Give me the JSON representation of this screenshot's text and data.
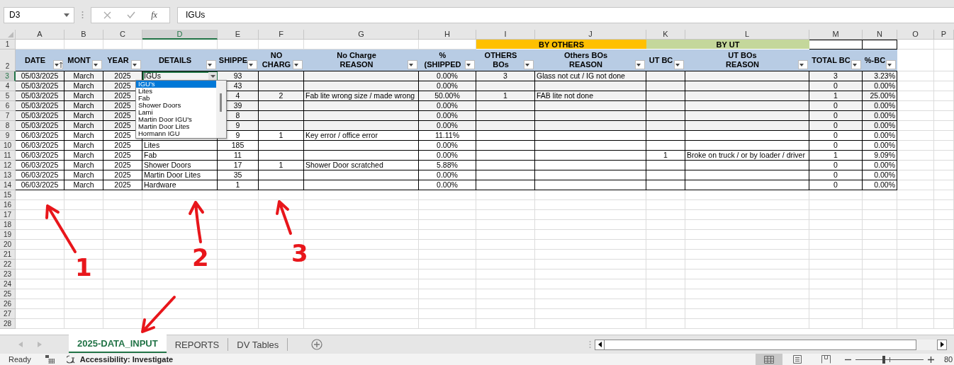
{
  "name_box": "D3",
  "function_button": "fx",
  "formula": "IGUs",
  "columns": [
    {
      "label": "A",
      "selected": false
    },
    {
      "label": "B",
      "selected": false
    },
    {
      "label": "C",
      "selected": false
    },
    {
      "label": "D",
      "selected": true
    },
    {
      "label": "E",
      "selected": false
    },
    {
      "label": "F",
      "selected": false
    },
    {
      "label": "G",
      "selected": false
    },
    {
      "label": "H",
      "selected": false
    },
    {
      "label": "I",
      "selected": false
    },
    {
      "label": "J",
      "selected": false
    },
    {
      "label": "K",
      "selected": false
    },
    {
      "label": "L",
      "selected": false
    },
    {
      "label": "M",
      "selected": false
    },
    {
      "label": "N",
      "selected": false
    },
    {
      "label": "O",
      "selected": false
    },
    {
      "label": "P",
      "selected": false
    }
  ],
  "group_headers": [
    {
      "label": "BY OTHERS",
      "color": "#ffc000"
    },
    {
      "label": "BY UT",
      "color": "#c4d79b"
    }
  ],
  "header_row": "2",
  "first_row": "1",
  "headers": [
    {
      "label": "DATE",
      "sorted": true
    },
    {
      "label": "MONT",
      "sorted": false
    },
    {
      "label": "YEAR",
      "sorted": false
    },
    {
      "label": "DETAILS",
      "sorted": false
    },
    {
      "label": "SHIPPE",
      "sorted": false
    },
    {
      "label": "NO\nCHARG",
      "sorted": false
    },
    {
      "label": "No Charge\nREASON",
      "sorted": false
    },
    {
      "label": "% (SHIPPED",
      "sorted": false
    },
    {
      "label": "OTHERS\nBOs",
      "sorted": false
    },
    {
      "label": "Others BOs\nREASON",
      "sorted": false
    },
    {
      "label": "UT BC",
      "sorted": false
    },
    {
      "label": "UT BOs\nREASON",
      "sorted": false
    },
    {
      "label": "TOTAL BC",
      "sorted": false
    },
    {
      "label": "%-BC",
      "sorted": false
    }
  ],
  "rows": [
    {
      "number": "3",
      "selected": true,
      "shaded": true,
      "date": "05/03/2025",
      "month": "March",
      "year": "2025",
      "details": "IGUs",
      "shipped": "93",
      "pct_shipped": "0.00%",
      "others_bos": "3",
      "others_reason": "Glass not cut / IG not done",
      "total_bos": "3",
      "pct_bos": "3.23%"
    },
    {
      "number": "4",
      "selected": false,
      "shaded": true,
      "date": "05/03/2025",
      "month": "March",
      "year": "2025",
      "shipped": "43",
      "pct_shipped": "0.00%",
      "total_bos": "0",
      "pct_bos": "0.00%"
    },
    {
      "number": "5",
      "selected": false,
      "shaded": true,
      "date": "05/03/2025",
      "month": "March",
      "year": "2025",
      "shipped": "4",
      "no_charge": "2",
      "no_charge_reason": "Fab lite wrong size / made wrong",
      "pct_shipped": "50.00%",
      "others_bos": "1",
      "others_reason": "FAB lite not done",
      "total_bos": "1",
      "pct_bos": "25.00%"
    },
    {
      "number": "6",
      "selected": false,
      "shaded": true,
      "date": "05/03/2025",
      "month": "March",
      "year": "2025",
      "shipped": "39",
      "pct_shipped": "0.00%",
      "total_bos": "0",
      "pct_bos": "0.00%"
    },
    {
      "number": "7",
      "selected": false,
      "shaded": true,
      "date": "05/03/2025",
      "month": "March",
      "year": "2025",
      "shipped": "8",
      "pct_shipped": "0.00%",
      "total_bos": "0",
      "pct_bos": "0.00%"
    },
    {
      "number": "8",
      "selected": false,
      "shaded": true,
      "date": "05/03/2025",
      "month": "March",
      "year": "2025",
      "shipped": "9",
      "pct_shipped": "0.00%",
      "total_bos": "0",
      "pct_bos": "0.00%"
    },
    {
      "number": "9",
      "selected": false,
      "shaded": false,
      "date": "06/03/2025",
      "month": "March",
      "year": "2025",
      "shipped": "9",
      "no_charge": "1",
      "no_charge_reason": "Key error / office error",
      "pct_shipped": "11.11%",
      "total_bos": "0",
      "pct_bos": "0.00%"
    },
    {
      "number": "10",
      "selected": false,
      "shaded": false,
      "date": "06/03/2025",
      "month": "March",
      "year": "2025",
      "details": "Lites",
      "shipped": "185",
      "pct_shipped": "0.00%",
      "total_bos": "0",
      "pct_bos": "0.00%"
    },
    {
      "number": "11",
      "selected": false,
      "shaded": false,
      "date": "06/03/2025",
      "month": "March",
      "year": "2025",
      "details": "Fab",
      "shipped": "11",
      "pct_shipped": "0.00%",
      "ut_bos": "1",
      "ut_reason": "Broke on truck / or by loader / driver",
      "total_bos": "1",
      "pct_bos": "9.09%"
    },
    {
      "number": "12",
      "selected": false,
      "shaded": false,
      "date": "06/03/2025",
      "month": "March",
      "year": "2025",
      "details": "Shower Doors",
      "shipped": "17",
      "no_charge": "1",
      "no_charge_reason": "Shower Door scratched",
      "pct_shipped": "5.88%",
      "total_bos": "0",
      "pct_bos": "0.00%"
    },
    {
      "number": "13",
      "selected": false,
      "shaded": false,
      "date": "06/03/2025",
      "month": "March",
      "year": "2025",
      "details": "Martin Door Lites",
      "shipped": "35",
      "pct_shipped": "0.00%",
      "total_bos": "0",
      "pct_bos": "0.00%"
    },
    {
      "number": "14",
      "selected": false,
      "shaded": false,
      "date": "06/03/2025",
      "month": "March",
      "year": "2025",
      "details": "Hardware",
      "shipped": "1",
      "pct_shipped": "0.00%",
      "total_bos": "0",
      "pct_bos": "0.00%"
    }
  ],
  "empty_rows": [
    "15",
    "16",
    "17",
    "18",
    "19",
    "20",
    "21",
    "22",
    "23",
    "24",
    "25",
    "26",
    "27",
    "28"
  ],
  "dropdown": {
    "items": [
      {
        "label": "IGU's",
        "selected": true
      },
      {
        "label": "Lites",
        "selected": false
      },
      {
        "label": "Fab",
        "selected": false
      },
      {
        "label": "Shower Doors",
        "selected": false
      },
      {
        "label": "Lami",
        "selected": false
      },
      {
        "label": "Martin Door IGU's",
        "selected": false
      },
      {
        "label": "Martin Door Lites",
        "selected": false
      },
      {
        "label": "Hormann IGU",
        "selected": false
      }
    ]
  },
  "annotations": [
    {
      "kind": "numbered",
      "label": "1"
    },
    {
      "kind": "numbered",
      "label": "2"
    },
    {
      "kind": "numbered",
      "label": "3"
    },
    {
      "kind": "arrow"
    }
  ],
  "sheet_tabs": [
    {
      "label": "2025-DATA_INPUT",
      "selected": true
    },
    {
      "label": "REPORTS",
      "selected": false
    },
    {
      "label": "DV Tables",
      "selected": false
    }
  ],
  "status_bar": {
    "mode": "Ready",
    "accessibility": "Accessibility: Investigate",
    "zoom": "80",
    "level": 0.42,
    "views": [
      {
        "kind": "normal",
        "selected": true
      },
      {
        "kind": "page_layout",
        "selected": false
      },
      {
        "kind": "page_break",
        "selected": false
      }
    ]
  }
}
